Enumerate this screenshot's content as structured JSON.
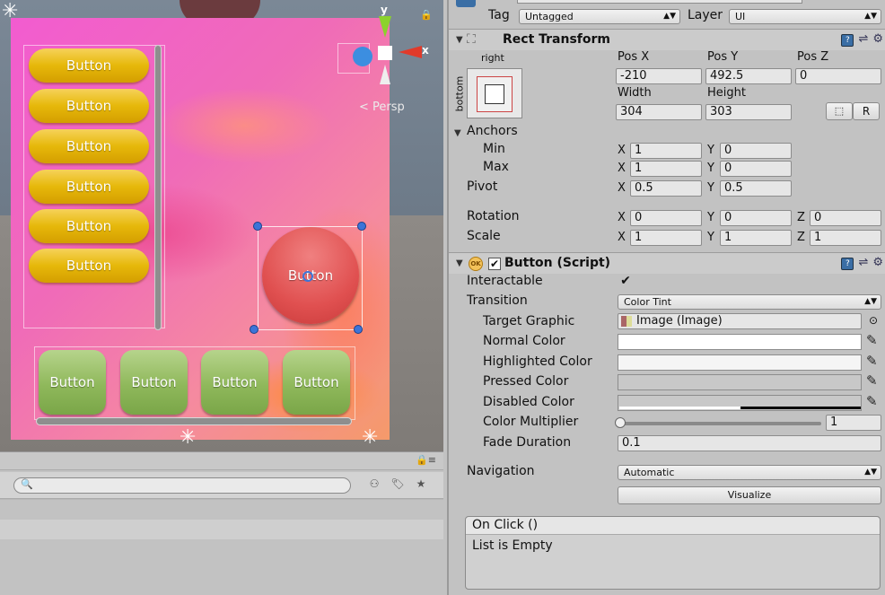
{
  "scene": {
    "buttons_yellow": [
      "Button",
      "Button",
      "Button",
      "Button",
      "Button",
      "Button"
    ],
    "buttons_green": [
      "Button",
      "Button",
      "Button",
      "Button"
    ],
    "button_red": "Button",
    "gizmo": {
      "y_label": "y",
      "x_label": "x",
      "persp_label": "< Persp"
    }
  },
  "project": {
    "search_placeholder": "Q"
  },
  "inspector": {
    "tag_label": "Tag",
    "tag_value": "Untagged",
    "layer_label": "Layer",
    "layer_value": "UI",
    "rect_transform": {
      "title": "Rect Transform",
      "anchor_preset_h": "right",
      "anchor_preset_v": "bottom",
      "pos_x_label": "Pos X",
      "pos_x": "-210",
      "pos_y_label": "Pos Y",
      "pos_y": "492.5",
      "pos_z_label": "Pos Z",
      "pos_z": "0",
      "width_label": "Width",
      "width": "304",
      "height_label": "Height",
      "height": "303",
      "raw_button": "R",
      "anchors_label": "Anchors",
      "min_label": "Min",
      "min_x": "1",
      "min_y": "0",
      "max_label": "Max",
      "max_x": "1",
      "max_y": "0",
      "pivot_label": "Pivot",
      "pivot_x": "0.5",
      "pivot_y": "0.5",
      "rotation_label": "Rotation",
      "rot_x": "0",
      "rot_y": "0",
      "rot_z": "0",
      "scale_label": "Scale",
      "scale_x": "1",
      "scale_y": "1",
      "scale_z": "1",
      "axis_x": "X",
      "axis_y": "Y",
      "axis_z": "Z"
    },
    "button_script": {
      "title": "Button (Script)",
      "icon_text": "OK",
      "interactable_label": "Interactable",
      "transition_label": "Transition",
      "transition_value": "Color Tint",
      "target_graphic_label": "Target Graphic",
      "target_graphic_value": "Image (Image)",
      "normal_color_label": "Normal Color",
      "highlighted_color_label": "Highlighted Color",
      "pressed_color_label": "Pressed Color",
      "disabled_color_label": "Disabled Color",
      "color_multiplier_label": "Color Multiplier",
      "color_multiplier_value": "1",
      "fade_duration_label": "Fade Duration",
      "fade_duration_value": "0.1",
      "navigation_label": "Navigation",
      "navigation_value": "Automatic",
      "visualize_button": "Visualize",
      "onclick_title": "On Click ()",
      "onclick_empty": "List is Empty"
    },
    "colors": {
      "normal": "#ffffff",
      "highlighted": "#f5f5f5",
      "pressed": "#c8c8c8",
      "disabled": "#c8c8c8"
    }
  }
}
